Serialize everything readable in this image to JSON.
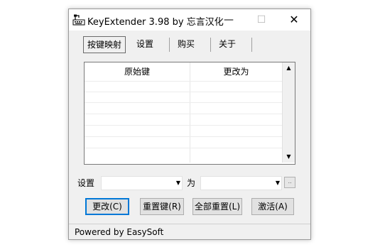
{
  "window": {
    "title": "KeyExtender 3.98 by 忘言汉化",
    "min_symbol": "—",
    "max_symbol": "☐",
    "close_symbol": "✕"
  },
  "tabs": [
    {
      "label": "按键映射",
      "active": true
    },
    {
      "label": "设置",
      "active": false
    },
    {
      "label": "购买",
      "active": false
    },
    {
      "label": "关于",
      "active": false
    }
  ],
  "mapping_list": {
    "columns": [
      "原始键",
      "更改为"
    ],
    "rows": []
  },
  "form": {
    "set_label": "设置",
    "to_label": "为",
    "source_key_value": "",
    "target_key_value": "",
    "browse_label": ".."
  },
  "buttons": {
    "change": "更改(C)",
    "reset_key": "重置键(R)",
    "reset_all": "全部重置(L)",
    "activate": "激活(A)"
  },
  "status": {
    "text": "Powered by EasySoft"
  }
}
